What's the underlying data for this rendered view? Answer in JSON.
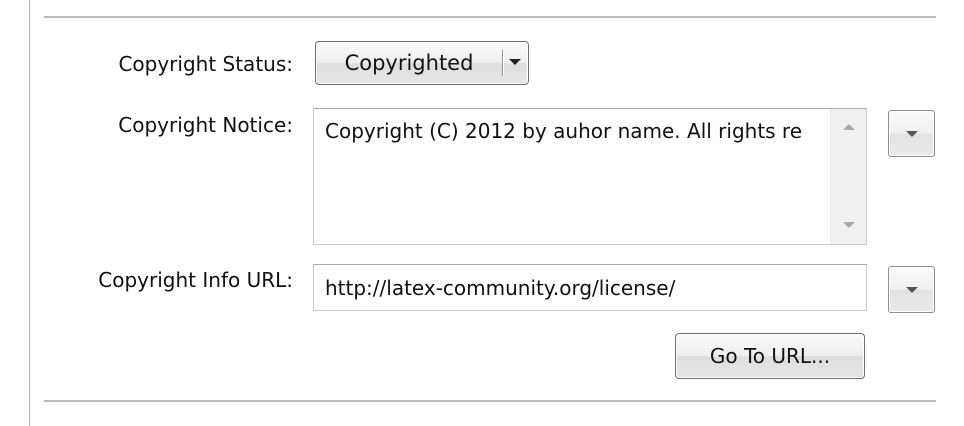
{
  "copyright": {
    "status_label": "Copyright Status:",
    "status_value": "Copyrighted",
    "notice_label": "Copyright Notice:",
    "notice_value": "Copyright (C) 2012 by auhor name. All rights re",
    "url_label": "Copyright Info URL:",
    "url_value": "http://latex-community.org/license/",
    "go_to_url_label": "Go To URL..."
  },
  "icons": {
    "dropdown": "chevron-down-icon",
    "scroll_up": "scroll-up-arrow-icon",
    "scroll_down": "scroll-down-arrow-icon"
  },
  "colors": {
    "background": "#ffffff",
    "separator": "#bdbdbd",
    "button_border": "#707070",
    "field_border": "#c9c9c9"
  }
}
